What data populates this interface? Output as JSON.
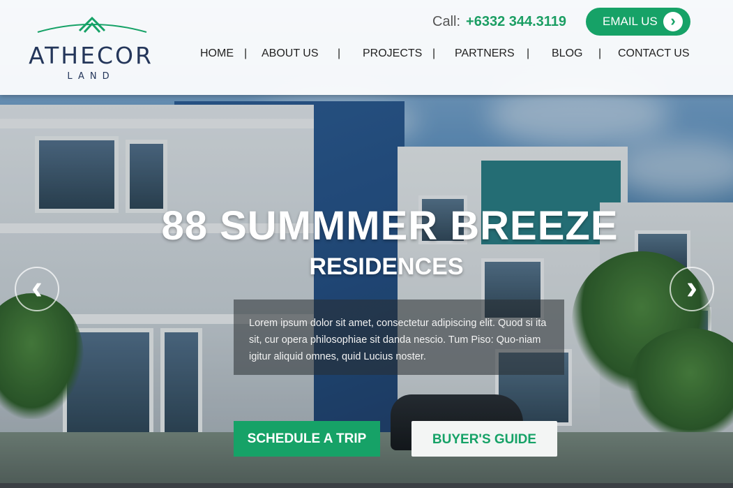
{
  "brand": {
    "name": "ATHECOR",
    "sub": "LAND",
    "accent_color": "#16a267",
    "logo_color": "#24365a"
  },
  "contact": {
    "call_label": "Call:",
    "phone": "+6332 344.3119",
    "email_label": "EMAIL US",
    "email_icon": "chevron-right-icon"
  },
  "nav": {
    "items": [
      "HOME",
      "ABOUT US",
      "PROJECTS",
      "PARTNERS",
      "BLOG",
      "CONTACT US"
    ],
    "separator": "|"
  },
  "hero": {
    "title": "88 SUMMMER BREEZE",
    "subtitle": "RESIDENCES",
    "description": "Lorem ipsum dolor sit amet, consectetur adipiscing elit. Quod si ita sit, cur opera philosophiae sit danda nescio. Tum Piso: Quo-niam igitur aliquid omnes, quid Lucius noster.",
    "prev_icon": "chevron-left-icon",
    "next_icon": "chevron-right-icon",
    "primary_button": "SCHEDULE A TRIP",
    "secondary_button": "BUYER'S GUIDE"
  }
}
